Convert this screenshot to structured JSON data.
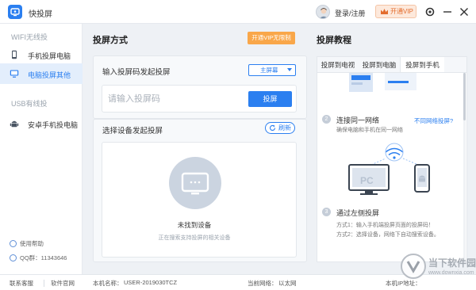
{
  "app": {
    "title": "快投屏"
  },
  "header": {
    "login_label": "登录/注册",
    "vip_label": "开通VIP"
  },
  "sidebar": {
    "wifi_heading": "WIFI无线投",
    "usb_heading": "USB有线投",
    "items": [
      {
        "label": "手机投屏电脑",
        "icon": "phone-icon"
      },
      {
        "label": "电脑投屏其他",
        "icon": "monitor-icon"
      },
      {
        "label": "安卓手机投电脑",
        "icon": "android-icon"
      }
    ],
    "help_label": "使用帮助",
    "qq_label": "QQ群：11343646"
  },
  "main": {
    "title": "投屏方式",
    "open_vip_label": "开通VIP无限制",
    "code_section_label": "输入投屏码发起投屏",
    "mode_select_value": "主屏幕",
    "code_placeholder": "请输入投屏码",
    "cast_button_label": "投屏",
    "device_section_label": "选择设备发起投屏",
    "refresh_label": "刷新",
    "empty_title": "未找到设备",
    "empty_subtitle": "正在搜索支持投屏的相关设备"
  },
  "tutorial": {
    "title": "投屏教程",
    "tabs": [
      "投屏到电视",
      "投屏到电脑",
      "投屏到手机"
    ],
    "active_tab": 2,
    "step2": {
      "number": "2",
      "title": "连接同一网络",
      "desc": "确保电脑和手机在同一网络",
      "link": "不同网络投屏?"
    },
    "illustration_pc_label": "PC",
    "step3": {
      "number": "3",
      "title": "通过左侧投屏",
      "desc1": "方式1：输入手机端投屏页面的投屏码！",
      "desc2": "方式2：选择设备，网络下自动搜索设备。"
    }
  },
  "statusbar": {
    "contact_label": "联系客服",
    "website_label": "软件官网",
    "machine_label": "本机名称：",
    "machine_value": "USER-2019030TCZ",
    "network_label": "当前网络：",
    "network_value": "以太网",
    "ip_label": "本机IP地址："
  },
  "watermark": {
    "text": "当下软件园",
    "url": "www.downxia.com"
  },
  "colors": {
    "accent": "#2b7ff0",
    "vip": "#f9a74a",
    "sidebar_active": "#e3eefc"
  }
}
